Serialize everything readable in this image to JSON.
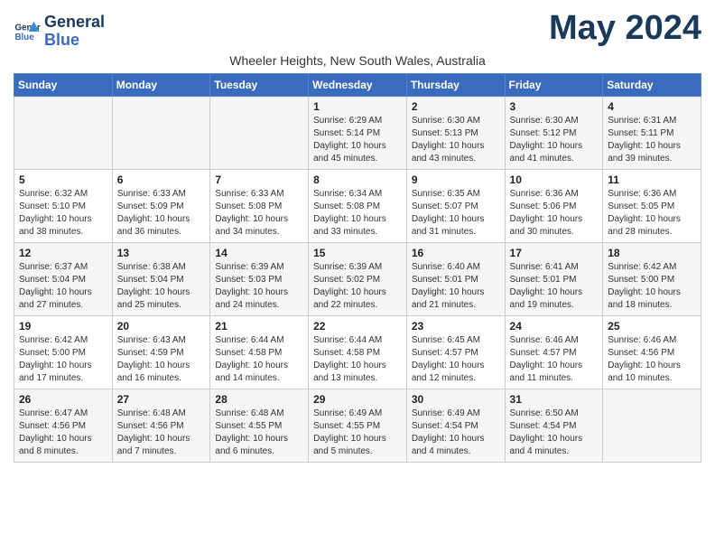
{
  "header": {
    "logo_line1": "General",
    "logo_line2": "Blue",
    "month_title": "May 2024",
    "subtitle": "Wheeler Heights, New South Wales, Australia"
  },
  "days_of_week": [
    "Sunday",
    "Monday",
    "Tuesday",
    "Wednesday",
    "Thursday",
    "Friday",
    "Saturday"
  ],
  "weeks": [
    [
      {
        "day": "",
        "info": ""
      },
      {
        "day": "",
        "info": ""
      },
      {
        "day": "",
        "info": ""
      },
      {
        "day": "1",
        "info": "Sunrise: 6:29 AM\nSunset: 5:14 PM\nDaylight: 10 hours\nand 45 minutes."
      },
      {
        "day": "2",
        "info": "Sunrise: 6:30 AM\nSunset: 5:13 PM\nDaylight: 10 hours\nand 43 minutes."
      },
      {
        "day": "3",
        "info": "Sunrise: 6:30 AM\nSunset: 5:12 PM\nDaylight: 10 hours\nand 41 minutes."
      },
      {
        "day": "4",
        "info": "Sunrise: 6:31 AM\nSunset: 5:11 PM\nDaylight: 10 hours\nand 39 minutes."
      }
    ],
    [
      {
        "day": "5",
        "info": "Sunrise: 6:32 AM\nSunset: 5:10 PM\nDaylight: 10 hours\nand 38 minutes."
      },
      {
        "day": "6",
        "info": "Sunrise: 6:33 AM\nSunset: 5:09 PM\nDaylight: 10 hours\nand 36 minutes."
      },
      {
        "day": "7",
        "info": "Sunrise: 6:33 AM\nSunset: 5:08 PM\nDaylight: 10 hours\nand 34 minutes."
      },
      {
        "day": "8",
        "info": "Sunrise: 6:34 AM\nSunset: 5:08 PM\nDaylight: 10 hours\nand 33 minutes."
      },
      {
        "day": "9",
        "info": "Sunrise: 6:35 AM\nSunset: 5:07 PM\nDaylight: 10 hours\nand 31 minutes."
      },
      {
        "day": "10",
        "info": "Sunrise: 6:36 AM\nSunset: 5:06 PM\nDaylight: 10 hours\nand 30 minutes."
      },
      {
        "day": "11",
        "info": "Sunrise: 6:36 AM\nSunset: 5:05 PM\nDaylight: 10 hours\nand 28 minutes."
      }
    ],
    [
      {
        "day": "12",
        "info": "Sunrise: 6:37 AM\nSunset: 5:04 PM\nDaylight: 10 hours\nand 27 minutes."
      },
      {
        "day": "13",
        "info": "Sunrise: 6:38 AM\nSunset: 5:04 PM\nDaylight: 10 hours\nand 25 minutes."
      },
      {
        "day": "14",
        "info": "Sunrise: 6:39 AM\nSunset: 5:03 PM\nDaylight: 10 hours\nand 24 minutes."
      },
      {
        "day": "15",
        "info": "Sunrise: 6:39 AM\nSunset: 5:02 PM\nDaylight: 10 hours\nand 22 minutes."
      },
      {
        "day": "16",
        "info": "Sunrise: 6:40 AM\nSunset: 5:01 PM\nDaylight: 10 hours\nand 21 minutes."
      },
      {
        "day": "17",
        "info": "Sunrise: 6:41 AM\nSunset: 5:01 PM\nDaylight: 10 hours\nand 19 minutes."
      },
      {
        "day": "18",
        "info": "Sunrise: 6:42 AM\nSunset: 5:00 PM\nDaylight: 10 hours\nand 18 minutes."
      }
    ],
    [
      {
        "day": "19",
        "info": "Sunrise: 6:42 AM\nSunset: 5:00 PM\nDaylight: 10 hours\nand 17 minutes."
      },
      {
        "day": "20",
        "info": "Sunrise: 6:43 AM\nSunset: 4:59 PM\nDaylight: 10 hours\nand 16 minutes."
      },
      {
        "day": "21",
        "info": "Sunrise: 6:44 AM\nSunset: 4:58 PM\nDaylight: 10 hours\nand 14 minutes."
      },
      {
        "day": "22",
        "info": "Sunrise: 6:44 AM\nSunset: 4:58 PM\nDaylight: 10 hours\nand 13 minutes."
      },
      {
        "day": "23",
        "info": "Sunrise: 6:45 AM\nSunset: 4:57 PM\nDaylight: 10 hours\nand 12 minutes."
      },
      {
        "day": "24",
        "info": "Sunrise: 6:46 AM\nSunset: 4:57 PM\nDaylight: 10 hours\nand 11 minutes."
      },
      {
        "day": "25",
        "info": "Sunrise: 6:46 AM\nSunset: 4:56 PM\nDaylight: 10 hours\nand 10 minutes."
      }
    ],
    [
      {
        "day": "26",
        "info": "Sunrise: 6:47 AM\nSunset: 4:56 PM\nDaylight: 10 hours\nand 8 minutes."
      },
      {
        "day": "27",
        "info": "Sunrise: 6:48 AM\nSunset: 4:56 PM\nDaylight: 10 hours\nand 7 minutes."
      },
      {
        "day": "28",
        "info": "Sunrise: 6:48 AM\nSunset: 4:55 PM\nDaylight: 10 hours\nand 6 minutes."
      },
      {
        "day": "29",
        "info": "Sunrise: 6:49 AM\nSunset: 4:55 PM\nDaylight: 10 hours\nand 5 minutes."
      },
      {
        "day": "30",
        "info": "Sunrise: 6:49 AM\nSunset: 4:54 PM\nDaylight: 10 hours\nand 4 minutes."
      },
      {
        "day": "31",
        "info": "Sunrise: 6:50 AM\nSunset: 4:54 PM\nDaylight: 10 hours\nand 4 minutes."
      },
      {
        "day": "",
        "info": ""
      }
    ]
  ]
}
